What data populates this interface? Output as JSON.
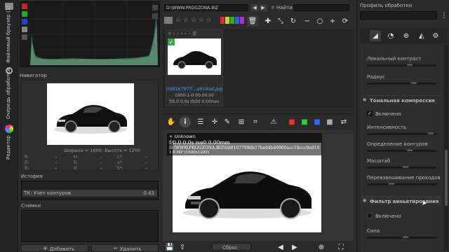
{
  "left_tabs": [
    "Файловый браузер (1)",
    "Очередь обработки",
    "Редактор"
  ],
  "navigator": {
    "title": "Навигатор",
    "size_text": "Ширина = 1600, Высота = 1200",
    "rgb_labels": [
      "R:",
      "G:",
      "B:"
    ],
    "rgb_values": [
      "--",
      "--",
      "--"
    ],
    "hsv_labels": [
      "H:",
      "S:",
      "V:"
    ],
    "hsv_values": [
      "--",
      "--",
      "--"
    ],
    "lab_labels": [
      "L*:",
      "a*:",
      "b*:"
    ],
    "lab_values": [
      "--",
      "--",
      "--"
    ]
  },
  "history": {
    "title": "История",
    "item_label": "ТК: Учет контуров",
    "item_value": "0.43"
  },
  "snapshots": {
    "title": "Снимки",
    "add_label": "Добавить",
    "remove_label": "Удалить"
  },
  "file_browser": {
    "path": "D:\\WWW.PROGZONA.BIZ",
    "search_label": "Найти:",
    "thumb_caption": "0d8167977...a918ad.jpg",
    "thumb_info1": "1900-1-0 00:00:00",
    "thumb_info2": "f/0.0 0.0s ISO0 0.00mm"
  },
  "preview": {
    "line1": "+ Unknown",
    "line2": "f/0.0  0.0s  iso0  0.00mm",
    "line3": "D:\\WWW.PROGZONA.BIZ\\0d8167799db17be64b49960acc18ccc9a918",
    "line4": "1.9 MP (1600x1200)",
    "bottom_btn": "Сброс"
  },
  "right_panel": {
    "title": "Профиль обработки",
    "local_contrast": "Локальный контраст",
    "radius": "Радиус",
    "tone_compression": "Тональная компрессия",
    "enabled": "Включено",
    "intensity": "Интенсивность",
    "edge_detection": "Определение контуров",
    "scale": "Масштаб",
    "reweighting": "Перевзвешивание проходов",
    "vignette_filter": "Фильтр виньетирования",
    "enabled2": "Включено",
    "strength": "Сила"
  },
  "colors": {
    "panel_bg": "#2b2b2b",
    "dark_bg": "#1f1f1f",
    "accent_green": "#3aa64a"
  }
}
